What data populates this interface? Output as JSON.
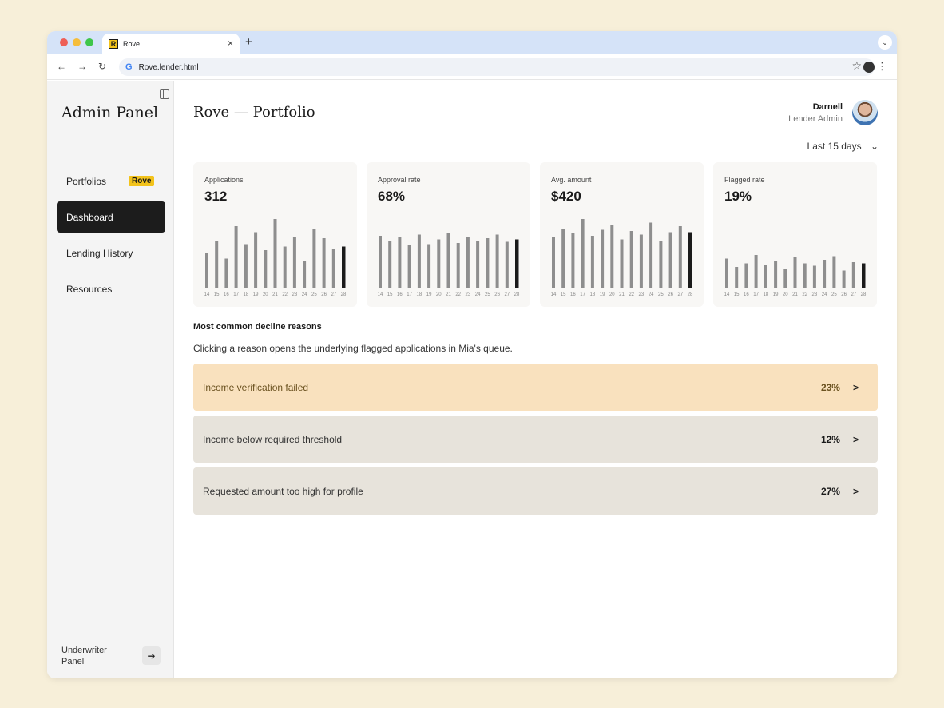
{
  "browser": {
    "tab_title": "Rove",
    "favicon_letter": "R",
    "url": "Rove.lender.html"
  },
  "sidebar": {
    "title": "Admin Panel",
    "items": [
      {
        "label": "Portfolios",
        "badge": "Rove"
      },
      {
        "label": "Dashboard"
      },
      {
        "label": "Lending History"
      },
      {
        "label": "Resources"
      }
    ],
    "active_index": 1,
    "footer_label": "Underwriter Panel"
  },
  "header": {
    "title": "Rove — Portfolio",
    "user_name": "Darnell",
    "user_role": "Lender Admin",
    "date_range": "Last 15 days"
  },
  "chart_data": [
    {
      "type": "bar",
      "title": "Applications",
      "value": "312",
      "categories": [
        "14",
        "15",
        "16",
        "17",
        "18",
        "19",
        "20",
        "21",
        "22",
        "23",
        "24",
        "25",
        "26",
        "27",
        "28"
      ],
      "values": [
        30,
        40,
        25,
        52,
        37,
        47,
        32,
        58,
        35,
        43,
        23,
        50,
        42,
        33,
        35
      ],
      "highlight_last": true
    },
    {
      "type": "bar",
      "title": "Approval rate",
      "value": "68%",
      "categories": [
        "14",
        "15",
        "16",
        "17",
        "18",
        "19",
        "20",
        "21",
        "22",
        "23",
        "24",
        "25",
        "26",
        "27",
        "28"
      ],
      "values": [
        44,
        40,
        43,
        36,
        45,
        37,
        41,
        46,
        38,
        43,
        40,
        42,
        45,
        39,
        41
      ],
      "highlight_last": true
    },
    {
      "type": "bar",
      "title": "Avg. amount",
      "value": "$420",
      "categories": [
        "14",
        "15",
        "16",
        "17",
        "18",
        "19",
        "20",
        "21",
        "22",
        "23",
        "24",
        "25",
        "26",
        "27",
        "28"
      ],
      "values": [
        43,
        50,
        46,
        58,
        44,
        49,
        53,
        41,
        48,
        45,
        55,
        40,
        47,
        52,
        47
      ],
      "highlight_last": true
    },
    {
      "type": "bar",
      "title": "Flagged rate",
      "value": "19%",
      "categories": [
        "14",
        "15",
        "16",
        "17",
        "18",
        "19",
        "20",
        "21",
        "22",
        "23",
        "24",
        "25",
        "26",
        "27",
        "28"
      ],
      "values": [
        25,
        18,
        21,
        28,
        20,
        23,
        16,
        26,
        21,
        19,
        24,
        27,
        15,
        22,
        21
      ],
      "highlight_last": true
    }
  ],
  "decline": {
    "title": "Most common decline reasons",
    "description": "Clicking a reason opens the underlying flagged applications in Mia's queue.",
    "reasons": [
      {
        "label": "Income verification failed",
        "pct": "23%",
        "highlighted": true
      },
      {
        "label": "Income below required threshold",
        "pct": "12%"
      },
      {
        "label": "Requested amount too high for profile",
        "pct": "27%"
      }
    ]
  },
  "colors": {
    "highlight_row": "#f9e1be",
    "normal_row": "#e7e3db",
    "bar": "#8e8e8e",
    "bar_last": "#1a1a1a",
    "accent": "#f3c31b"
  }
}
